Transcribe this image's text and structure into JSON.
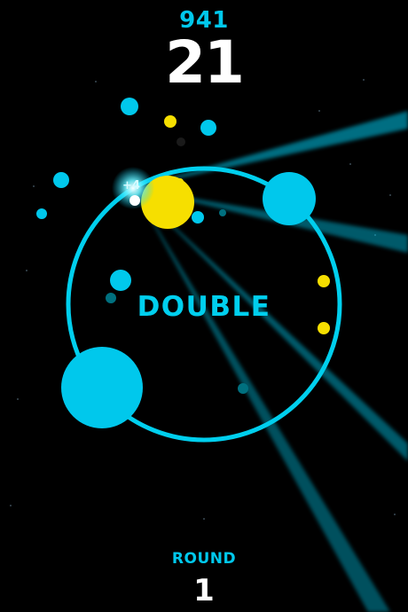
{
  "hud": {
    "best_score": "941",
    "score": "21",
    "mode_label": "DOUBLE",
    "combo_popup": "+4",
    "round_label": "ROUND",
    "round_number": "1"
  },
  "colors": {
    "background": "#000000",
    "ring": "#00cfee",
    "primary": "#00c8ec",
    "accent_yellow": "#f6df00",
    "text_white": "#ffffff",
    "dim_dot": "#00707f"
  }
}
